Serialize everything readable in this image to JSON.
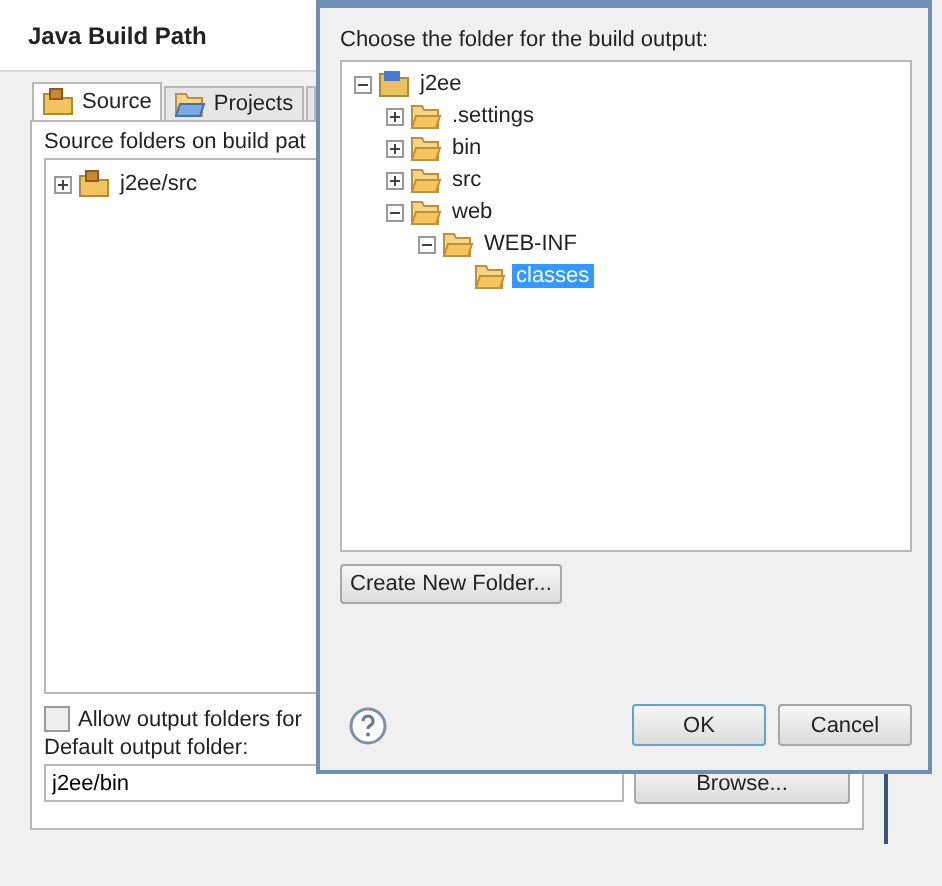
{
  "window": {
    "title": "Java Build Path"
  },
  "tabs": [
    {
      "label": "Source",
      "selected": true,
      "kind": "source"
    },
    {
      "label": "Projects",
      "selected": false,
      "kind": "projects"
    },
    {
      "selected": false,
      "kind": "cut"
    }
  ],
  "source_label": "Source folders on build pat",
  "source_tree": [
    {
      "label": "j2ee/src",
      "kind": "source",
      "expanded": false,
      "selected": false
    }
  ],
  "allow_output": {
    "label": "Allow output folders for",
    "checked": false
  },
  "output_folder": {
    "label": "Default output folder:",
    "value": "j2ee/bin",
    "button": "Browse..."
  },
  "dialog": {
    "prompt": "Choose the folder for the build output:",
    "tree": [
      {
        "label": "j2ee",
        "kind": "project",
        "expanded": true,
        "selected": false,
        "children": [
          {
            "label": ".settings",
            "kind": "folder",
            "expanded": false,
            "selected": false
          },
          {
            "label": "bin",
            "kind": "folder",
            "expanded": false,
            "selected": false
          },
          {
            "label": "src",
            "kind": "folder",
            "expanded": false,
            "selected": false
          },
          {
            "label": "web",
            "kind": "folder",
            "expanded": true,
            "selected": false,
            "children": [
              {
                "label": "WEB-INF",
                "kind": "folder",
                "expanded": true,
                "selected": false,
                "children": [
                  {
                    "label": "classes",
                    "kind": "folder",
                    "selected": true
                  }
                ]
              }
            ]
          }
        ]
      }
    ],
    "create_button": "Create New Folder...",
    "buttons": [
      {
        "label": "OK",
        "kind": "default"
      },
      {
        "label": "Cancel",
        "kind": "normal"
      }
    ]
  }
}
